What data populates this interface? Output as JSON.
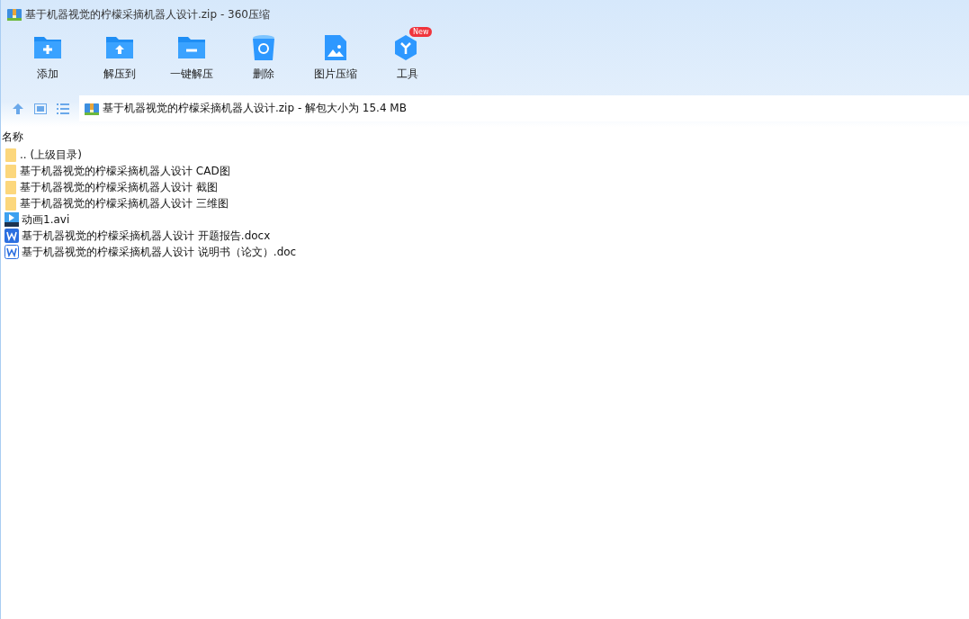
{
  "window": {
    "title": "基于机器视觉的柠檬采摘机器人设计.zip - 360压缩"
  },
  "toolbar": [
    {
      "kind": "add",
      "label": "添加"
    },
    {
      "kind": "extract",
      "label": "解压到"
    },
    {
      "kind": "oneclick",
      "label": "一键解压"
    },
    {
      "kind": "delete",
      "label": "删除"
    },
    {
      "kind": "image",
      "label": "图片压缩"
    },
    {
      "kind": "tools",
      "label": "工具",
      "badge": "New"
    }
  ],
  "address": {
    "path": "基于机器视觉的柠檬采摘机器人设计.zip - 解包大小为 15.4 MB"
  },
  "list": {
    "columns": [
      "名称"
    ],
    "rows": [
      {
        "kind": "folder",
        "name": ".. (上级目录)"
      },
      {
        "kind": "folder",
        "name": "基于机器视觉的柠檬采摘机器人设计 CAD图"
      },
      {
        "kind": "folder",
        "name": "基于机器视觉的柠檬采摘机器人设计 截图"
      },
      {
        "kind": "folder",
        "name": "基于机器视觉的柠檬采摘机器人设计 三维图"
      },
      {
        "kind": "video",
        "name": "动画1.avi"
      },
      {
        "kind": "docx",
        "name": "基于机器视觉的柠檬采摘机器人设计 开题报告.docx"
      },
      {
        "kind": "doc",
        "name": "基于机器视觉的柠檬采摘机器人设计 说明书（论文）.doc"
      }
    ]
  }
}
